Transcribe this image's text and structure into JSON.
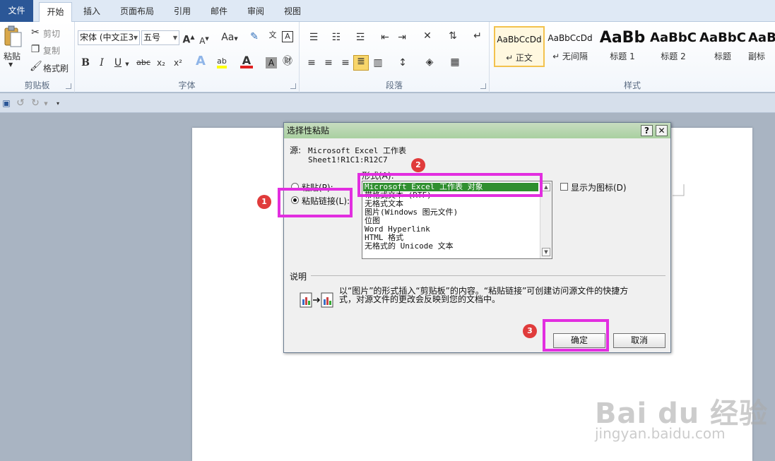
{
  "tabs": {
    "file": "文件",
    "home": "开始",
    "insert": "插入",
    "layout": "页面布局",
    "references": "引用",
    "mailings": "邮件",
    "review": "审阅",
    "view": "视图"
  },
  "clipboard": {
    "paste": "粘贴",
    "cut": "剪切",
    "copy": "复制",
    "format_painter": "格式刷",
    "label": "剪贴板"
  },
  "font": {
    "name": "宋体 (中文正3",
    "size": "五号",
    "grow": "A",
    "shrink": "A",
    "case": "Aa",
    "bold": "B",
    "italic": "I",
    "underline": "U",
    "strike": "abc",
    "sub": "x₂",
    "sup": "x²",
    "label": "字体"
  },
  "paragraph": {
    "label": "段落"
  },
  "styles": {
    "label": "样式",
    "items": [
      {
        "sample": "AaBbCcDd",
        "name": "↵ 正文"
      },
      {
        "sample": "AaBbCcDd",
        "name": "↵ 无间隔"
      },
      {
        "sample": "AaBb",
        "name": "标题 1"
      },
      {
        "sample": "AaBbC",
        "name": "标题 2"
      },
      {
        "sample": "AaBbC",
        "name": "标题"
      },
      {
        "sample": "AaB",
        "name": "副标"
      }
    ]
  },
  "dialog": {
    "title": "选择性粘贴",
    "help": "?",
    "close": "✕",
    "source_label": "源:",
    "source_line1": "Microsoft Excel 工作表",
    "source_line2": "Sheet1!R1C1:R12C7",
    "format_label": "形式(A):",
    "radio_paste": "粘贴(P):",
    "radio_paste_link": "粘贴链接(L):",
    "list_items": [
      "Microsoft Excel 工作表 对象",
      "带格式文本 (RTF)",
      "无格式文本",
      "图片(Windows 图元文件)",
      "位图",
      "Word Hyperlink",
      "HTML 格式",
      "无格式的 Unicode 文本"
    ],
    "display_as_icon": "显示为图标(D)",
    "description_label": "说明",
    "description_line1": "以“图片”的形式插入“剪贴板”的内容。“粘贴链接”可创建访问源文件的快捷方",
    "description_line2": "式，对源文件的更改会反映到您的文档中。",
    "ok": "确定",
    "cancel": "取消"
  },
  "annotations": {
    "badge1": "1",
    "badge2": "2",
    "badge3": "3"
  },
  "watermark": {
    "logo": "Bai du 经验",
    "url": "jingyan.baidu.com"
  }
}
